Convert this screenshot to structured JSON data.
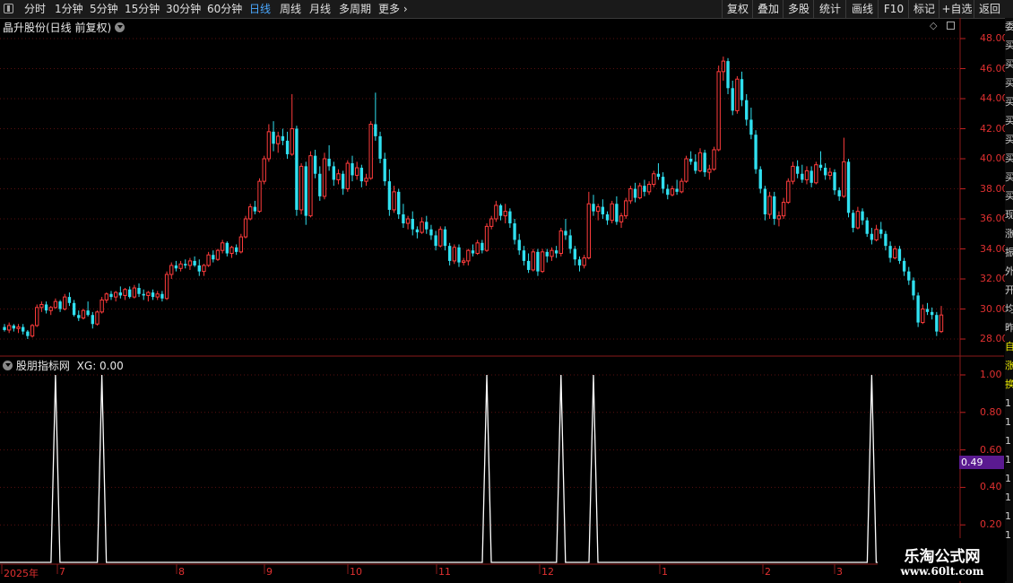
{
  "toolbar": {
    "periods": [
      "分时",
      "1分钟",
      "5分钟",
      "15分钟",
      "30分钟",
      "60分钟",
      "日线",
      "周线",
      "月线",
      "多周期",
      "更多"
    ],
    "active_period": "日线",
    "right_buttons": [
      "复权",
      "叠加",
      "多股",
      "统计",
      "画线",
      "F10",
      "标记",
      "+自选",
      "返回"
    ]
  },
  "main_panel": {
    "title": "晶升股份(日线 前复权)"
  },
  "indicator_panel": {
    "title": "股朋指标网",
    "value_text": "XG: 0.00",
    "cursor_value": "0.49"
  },
  "price_axis": {
    "labels": [
      "48.00",
      "46.00",
      "44.00",
      "42.00",
      "40.00",
      "38.00",
      "36.00",
      "34.00",
      "32.00",
      "30.00",
      "28.00"
    ]
  },
  "indicator_axis": {
    "labels": [
      "1.00",
      "0.80",
      "0.60",
      "0.40",
      "0.20"
    ]
  },
  "date_axis": {
    "labels": [
      "2025年",
      "7",
      "8",
      "9",
      "10",
      "11",
      "12",
      "1",
      "2",
      "3"
    ]
  },
  "right_panel_chars": [
    "委",
    "买",
    "买",
    "买",
    "买",
    "买",
    "买",
    "买",
    "买",
    "买",
    "现",
    "涨",
    "振",
    "外",
    "开",
    "均",
    "昨",
    "自",
    "涨",
    "换",
    "1",
    "1",
    "1",
    "1",
    "1",
    "1",
    "1",
    "1"
  ],
  "watermark": {
    "line1": "乐淘公式网",
    "line2": "www.60lt.com"
  },
  "colors": {
    "up": "#ff3c3c",
    "down": "#30e0f0",
    "axis": "#e03030",
    "grid": "#5a1010",
    "active": "#4aa8ff",
    "signal": "#ffffff",
    "cursor_box": "#5a1a90"
  },
  "chart_data": [
    {
      "type": "candlestick",
      "title": "晶升股份(日线 前复权)",
      "ylim": [
        27.5,
        48.5
      ],
      "candles": [
        [
          28.8,
          29.0,
          28.5,
          28.6
        ],
        [
          28.6,
          29.1,
          28.4,
          28.9
        ],
        [
          28.9,
          29.0,
          28.5,
          28.7
        ],
        [
          28.7,
          29.0,
          28.4,
          28.8
        ],
        [
          28.8,
          29.0,
          28.3,
          28.5
        ],
        [
          28.5,
          28.6,
          28.0,
          28.2
        ],
        [
          28.2,
          29.0,
          28.1,
          28.9
        ],
        [
          28.9,
          30.3,
          28.8,
          30.1
        ],
        [
          30.1,
          30.5,
          29.8,
          30.3
        ],
        [
          30.3,
          30.5,
          29.7,
          29.9
        ],
        [
          29.9,
          30.2,
          29.6,
          30.1
        ],
        [
          30.1,
          30.7,
          30.0,
          30.5
        ],
        [
          30.5,
          30.6,
          29.8,
          30.0
        ],
        [
          30.0,
          31.0,
          29.9,
          30.8
        ],
        [
          30.8,
          31.1,
          30.2,
          30.4
        ],
        [
          30.4,
          30.6,
          29.5,
          29.6
        ],
        [
          29.6,
          29.9,
          29.2,
          29.4
        ],
        [
          29.4,
          30.0,
          29.3,
          29.9
        ],
        [
          29.9,
          30.5,
          29.5,
          29.6
        ],
        [
          29.6,
          29.8,
          28.7,
          29.0
        ],
        [
          29.0,
          29.9,
          28.9,
          29.8
        ],
        [
          29.8,
          30.8,
          29.7,
          30.6
        ],
        [
          30.6,
          31.1,
          30.4,
          31.0
        ],
        [
          31.0,
          31.2,
          30.6,
          30.8
        ],
        [
          30.8,
          31.2,
          30.5,
          31.1
        ],
        [
          31.1,
          31.5,
          30.7,
          30.9
        ],
        [
          30.9,
          31.4,
          30.6,
          31.3
        ],
        [
          31.3,
          31.5,
          30.7,
          30.8
        ],
        [
          30.8,
          31.6,
          30.7,
          31.4
        ],
        [
          31.4,
          31.7,
          30.8,
          31.0
        ],
        [
          31.0,
          31.3,
          30.6,
          30.9
        ],
        [
          30.9,
          31.2,
          30.5,
          31.1
        ],
        [
          31.1,
          31.3,
          30.6,
          30.8
        ],
        [
          30.8,
          31.2,
          30.6,
          31.0
        ],
        [
          31.0,
          31.2,
          30.5,
          30.7
        ],
        [
          30.7,
          32.5,
          30.6,
          32.3
        ],
        [
          32.3,
          33.1,
          32.0,
          32.9
        ],
        [
          32.9,
          33.2,
          32.5,
          32.7
        ],
        [
          32.7,
          33.2,
          32.5,
          33.0
        ],
        [
          33.0,
          33.3,
          32.7,
          32.9
        ],
        [
          32.9,
          33.4,
          32.6,
          33.2
        ],
        [
          33.2,
          33.5,
          32.8,
          32.9
        ],
        [
          32.9,
          33.3,
          32.2,
          32.5
        ],
        [
          32.5,
          33.0,
          32.2,
          32.9
        ],
        [
          32.9,
          33.8,
          32.8,
          33.6
        ],
        [
          33.6,
          33.9,
          33.1,
          33.3
        ],
        [
          33.3,
          34.0,
          33.2,
          33.9
        ],
        [
          33.9,
          34.6,
          33.7,
          34.4
        ],
        [
          34.4,
          34.5,
          33.5,
          33.7
        ],
        [
          33.7,
          34.2,
          33.4,
          34.1
        ],
        [
          34.1,
          34.3,
          33.6,
          33.8
        ],
        [
          33.8,
          35.0,
          33.7,
          34.8
        ],
        [
          34.8,
          36.2,
          34.7,
          36.0
        ],
        [
          36.0,
          37.0,
          35.9,
          36.8
        ],
        [
          36.8,
          37.2,
          36.3,
          36.5
        ],
        [
          36.5,
          38.7,
          36.4,
          38.5
        ],
        [
          38.5,
          40.2,
          38.3,
          40.0
        ],
        [
          40.0,
          42.3,
          39.8,
          41.8
        ],
        [
          41.8,
          42.5,
          40.5,
          41.0
        ],
        [
          41.0,
          41.8,
          40.4,
          41.5
        ],
        [
          41.5,
          42.0,
          40.9,
          41.2
        ],
        [
          41.2,
          41.8,
          40.0,
          40.3
        ],
        [
          40.3,
          44.3,
          40.2,
          42.0
        ],
        [
          42.0,
          42.2,
          36.2,
          36.6
        ],
        [
          36.6,
          39.7,
          36.3,
          39.5
        ],
        [
          39.5,
          39.8,
          35.6,
          36.2
        ],
        [
          36.2,
          40.5,
          36.1,
          40.2
        ],
        [
          40.2,
          40.6,
          38.7,
          39.0
        ],
        [
          39.0,
          39.5,
          37.2,
          37.5
        ],
        [
          37.5,
          40.4,
          37.3,
          40.0
        ],
        [
          40.0,
          40.9,
          39.2,
          39.5
        ],
        [
          39.5,
          39.8,
          38.2,
          38.6
        ],
        [
          38.6,
          39.3,
          38.3,
          39.0
        ],
        [
          39.0,
          39.2,
          37.6,
          38.0
        ],
        [
          38.0,
          39.9,
          37.8,
          39.7
        ],
        [
          39.7,
          40.2,
          38.5,
          38.9
        ],
        [
          38.9,
          39.8,
          38.6,
          39.4
        ],
        [
          39.4,
          39.6,
          38.1,
          38.5
        ],
        [
          38.5,
          39.0,
          38.2,
          38.7
        ],
        [
          38.7,
          42.5,
          38.6,
          42.3
        ],
        [
          42.3,
          44.4,
          41.2,
          41.5
        ],
        [
          41.5,
          41.8,
          39.7,
          40.0
        ],
        [
          40.0,
          40.4,
          38.2,
          38.5
        ],
        [
          38.5,
          39.3,
          36.2,
          36.6
        ],
        [
          36.6,
          38.2,
          36.4,
          37.8
        ],
        [
          37.8,
          38.0,
          36.0,
          36.3
        ],
        [
          36.3,
          37.0,
          35.4,
          35.7
        ],
        [
          35.7,
          36.2,
          35.3,
          36.0
        ],
        [
          36.0,
          36.5,
          34.9,
          35.3
        ],
        [
          35.3,
          35.5,
          34.7,
          35.1
        ],
        [
          35.1,
          36.1,
          35.0,
          35.8
        ],
        [
          35.8,
          36.2,
          35.0,
          35.3
        ],
        [
          35.3,
          35.6,
          34.6,
          34.9
        ],
        [
          34.9,
          35.2,
          33.9,
          34.2
        ],
        [
          34.2,
          35.5,
          34.1,
          35.3
        ],
        [
          35.3,
          35.5,
          33.9,
          34.2
        ],
        [
          34.2,
          34.4,
          32.9,
          33.2
        ],
        [
          33.2,
          34.3,
          33.0,
          34.1
        ],
        [
          34.1,
          34.3,
          32.8,
          33.1
        ],
        [
          33.1,
          33.4,
          32.9,
          33.2
        ],
        [
          33.2,
          34.0,
          32.9,
          33.9
        ],
        [
          33.9,
          34.3,
          33.5,
          33.7
        ],
        [
          33.7,
          34.6,
          33.6,
          34.4
        ],
        [
          34.4,
          34.6,
          33.7,
          33.9
        ],
        [
          33.9,
          35.7,
          33.8,
          35.5
        ],
        [
          35.5,
          36.2,
          35.3,
          36.0
        ],
        [
          36.0,
          37.2,
          35.8,
          36.9
        ],
        [
          36.9,
          37.0,
          35.9,
          36.2
        ],
        [
          36.2,
          37.0,
          35.7,
          36.5
        ],
        [
          36.5,
          36.7,
          35.4,
          35.7
        ],
        [
          35.7,
          36.0,
          34.3,
          34.6
        ],
        [
          34.6,
          35.0,
          33.6,
          33.9
        ],
        [
          33.9,
          34.2,
          32.9,
          33.2
        ],
        [
          33.2,
          33.7,
          32.4,
          32.6
        ],
        [
          32.6,
          34.0,
          32.5,
          33.8
        ],
        [
          33.8,
          34.0,
          32.2,
          32.5
        ],
        [
          32.5,
          34.0,
          32.4,
          33.8
        ],
        [
          33.8,
          34.0,
          33.1,
          33.5
        ],
        [
          33.5,
          34.1,
          33.2,
          33.9
        ],
        [
          33.9,
          34.2,
          33.4,
          33.7
        ],
        [
          33.7,
          35.4,
          33.5,
          35.2
        ],
        [
          35.2,
          36.0,
          34.6,
          34.9
        ],
        [
          34.9,
          35.3,
          33.7,
          34.0
        ],
        [
          34.0,
          34.2,
          32.9,
          33.3
        ],
        [
          33.3,
          33.5,
          32.5,
          32.9
        ],
        [
          32.9,
          33.6,
          32.7,
          33.4
        ],
        [
          33.4,
          37.8,
          33.3,
          37.0
        ],
        [
          37.0,
          37.6,
          36.2,
          36.5
        ],
        [
          36.5,
          37.0,
          35.9,
          36.8
        ],
        [
          36.8,
          37.3,
          36.0,
          36.3
        ],
        [
          36.3,
          36.5,
          35.6,
          35.9
        ],
        [
          35.9,
          37.2,
          35.7,
          37.0
        ],
        [
          37.0,
          37.5,
          35.6,
          35.8
        ],
        [
          35.8,
          36.4,
          35.4,
          36.2
        ],
        [
          36.2,
          37.4,
          36.0,
          37.2
        ],
        [
          37.2,
          38.2,
          37.0,
          38.0
        ],
        [
          38.0,
          38.4,
          37.1,
          37.4
        ],
        [
          37.4,
          38.4,
          37.3,
          38.2
        ],
        [
          38.2,
          38.6,
          37.5,
          37.8
        ],
        [
          37.8,
          38.5,
          37.6,
          38.3
        ],
        [
          38.3,
          39.2,
          38.1,
          39.0
        ],
        [
          39.0,
          39.7,
          38.6,
          38.8
        ],
        [
          38.8,
          39.1,
          37.7,
          38.0
        ],
        [
          38.0,
          38.3,
          37.3,
          37.6
        ],
        [
          37.6,
          38.2,
          37.5,
          38.0
        ],
        [
          38.0,
          38.6,
          37.6,
          37.8
        ],
        [
          37.8,
          38.7,
          37.7,
          38.5
        ],
        [
          38.5,
          40.2,
          38.4,
          40.0
        ],
        [
          40.0,
          40.5,
          39.6,
          39.8
        ],
        [
          39.8,
          40.3,
          39.0,
          39.2
        ],
        [
          39.2,
          40.7,
          39.1,
          40.4
        ],
        [
          40.4,
          40.6,
          38.8,
          39.1
        ],
        [
          39.1,
          39.6,
          38.6,
          39.3
        ],
        [
          39.3,
          40.8,
          39.2,
          40.6
        ],
        [
          40.6,
          46.2,
          40.5,
          45.8
        ],
        [
          45.8,
          46.8,
          45.2,
          46.5
        ],
        [
          46.5,
          46.7,
          44.3,
          44.7
        ],
        [
          44.7,
          45.2,
          42.9,
          43.2
        ],
        [
          43.2,
          45.5,
          43.0,
          45.3
        ],
        [
          45.3,
          45.8,
          43.5,
          43.9
        ],
        [
          43.9,
          44.3,
          42.2,
          42.6
        ],
        [
          42.6,
          43.4,
          41.3,
          41.6
        ],
        [
          41.6,
          41.9,
          39.0,
          39.3
        ],
        [
          39.3,
          39.5,
          37.7,
          38.0
        ],
        [
          38.0,
          38.2,
          35.9,
          36.3
        ],
        [
          36.3,
          37.8,
          36.0,
          37.5
        ],
        [
          37.5,
          37.8,
          35.6,
          36.0
        ],
        [
          36.0,
          36.5,
          35.5,
          36.2
        ],
        [
          36.2,
          37.4,
          36.0,
          37.1
        ],
        [
          37.1,
          38.7,
          37.0,
          38.5
        ],
        [
          38.5,
          39.8,
          38.3,
          39.5
        ],
        [
          39.5,
          39.9,
          38.7,
          39.0
        ],
        [
          39.0,
          39.6,
          38.4,
          38.6
        ],
        [
          38.6,
          39.5,
          38.3,
          39.2
        ],
        [
          39.2,
          39.5,
          38.1,
          38.4
        ],
        [
          38.4,
          39.8,
          38.3,
          39.6
        ],
        [
          39.6,
          40.5,
          39.2,
          39.4
        ],
        [
          39.4,
          39.7,
          38.6,
          38.9
        ],
        [
          38.9,
          39.4,
          38.6,
          39.1
        ],
        [
          39.1,
          39.3,
          37.6,
          37.9
        ],
        [
          37.9,
          38.1,
          37.2,
          37.5
        ],
        [
          37.5,
          41.4,
          37.4,
          39.8
        ],
        [
          39.8,
          40.0,
          36.1,
          36.4
        ],
        [
          36.4,
          36.6,
          35.1,
          35.4
        ],
        [
          35.4,
          36.8,
          35.3,
          36.5
        ],
        [
          36.5,
          36.7,
          35.6,
          35.9
        ],
        [
          35.9,
          36.1,
          34.8,
          35.0
        ],
        [
          35.0,
          35.4,
          34.3,
          34.6
        ],
        [
          34.6,
          35.6,
          34.5,
          35.3
        ],
        [
          35.3,
          35.8,
          34.7,
          35.0
        ],
        [
          35.0,
          35.2,
          33.9,
          34.2
        ],
        [
          34.2,
          34.5,
          33.1,
          33.4
        ],
        [
          33.4,
          34.2,
          33.3,
          34.0
        ],
        [
          34.0,
          34.2,
          33.0,
          33.2
        ],
        [
          33.2,
          33.4,
          32.2,
          32.5
        ],
        [
          32.5,
          32.8,
          31.6,
          31.9
        ],
        [
          31.9,
          32.1,
          30.6,
          30.9
        ],
        [
          30.9,
          31.1,
          28.8,
          29.1
        ],
        [
          29.1,
          30.3,
          29.0,
          30.0
        ],
        [
          30.0,
          30.4,
          29.6,
          29.8
        ],
        [
          29.8,
          30.1,
          29.3,
          29.6
        ],
        [
          29.6,
          29.8,
          28.2,
          28.5
        ],
        [
          28.5,
          30.2,
          28.4,
          29.6
        ]
      ]
    },
    {
      "type": "line",
      "title": "股朋指标网",
      "series": [
        {
          "name": "XG",
          "signal_indices": [
            7,
            17,
            100,
            116,
            123,
            183
          ]
        }
      ],
      "ylim": [
        0,
        1.05
      ]
    }
  ]
}
